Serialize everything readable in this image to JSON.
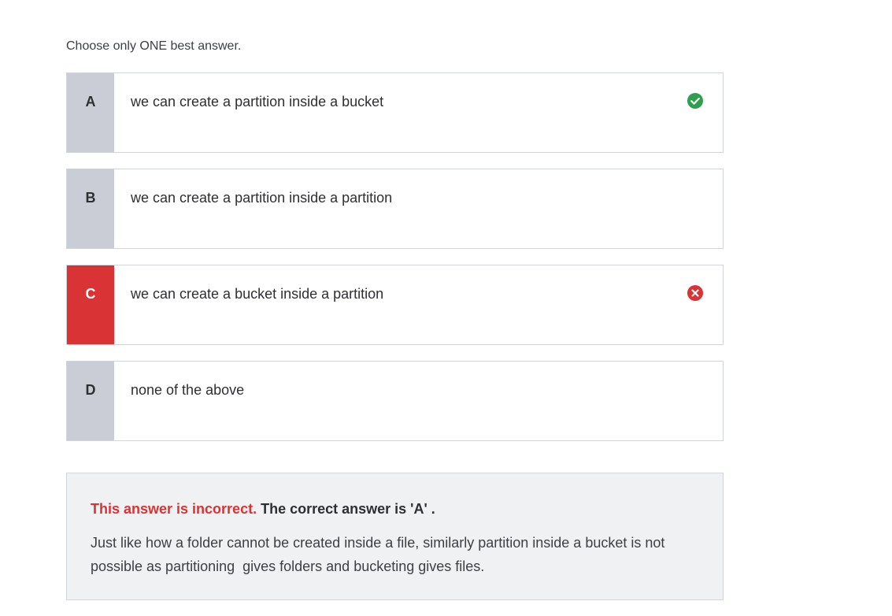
{
  "instruction": "Choose only ONE best answer.",
  "options": [
    {
      "letter": "A",
      "text": "we can create a partition inside a bucket",
      "status": "correct"
    },
    {
      "letter": "B",
      "text": "we can create a partition inside a partition",
      "status": "none"
    },
    {
      "letter": "C",
      "text": "we can create a bucket inside a partition",
      "status": "selected-wrong"
    },
    {
      "letter": "D",
      "text": "none of the above",
      "status": "none"
    }
  ],
  "feedback": {
    "incorrect_label": "This answer is incorrect.",
    "correct_answer_text": " The correct answer is 'A' .",
    "explanation": "Just like how a folder cannot be created inside a file, similarly partition inside a bucket is not possible as partitioning  gives folders and bucketing gives files."
  },
  "colors": {
    "correct": "#2e9e4f",
    "wrong": "#d93335",
    "letter_bg": "#cacdd6",
    "feedback_bg": "#f0f1f3"
  },
  "icons": {
    "correct": "check-circle-icon",
    "wrong": "x-circle-icon"
  }
}
